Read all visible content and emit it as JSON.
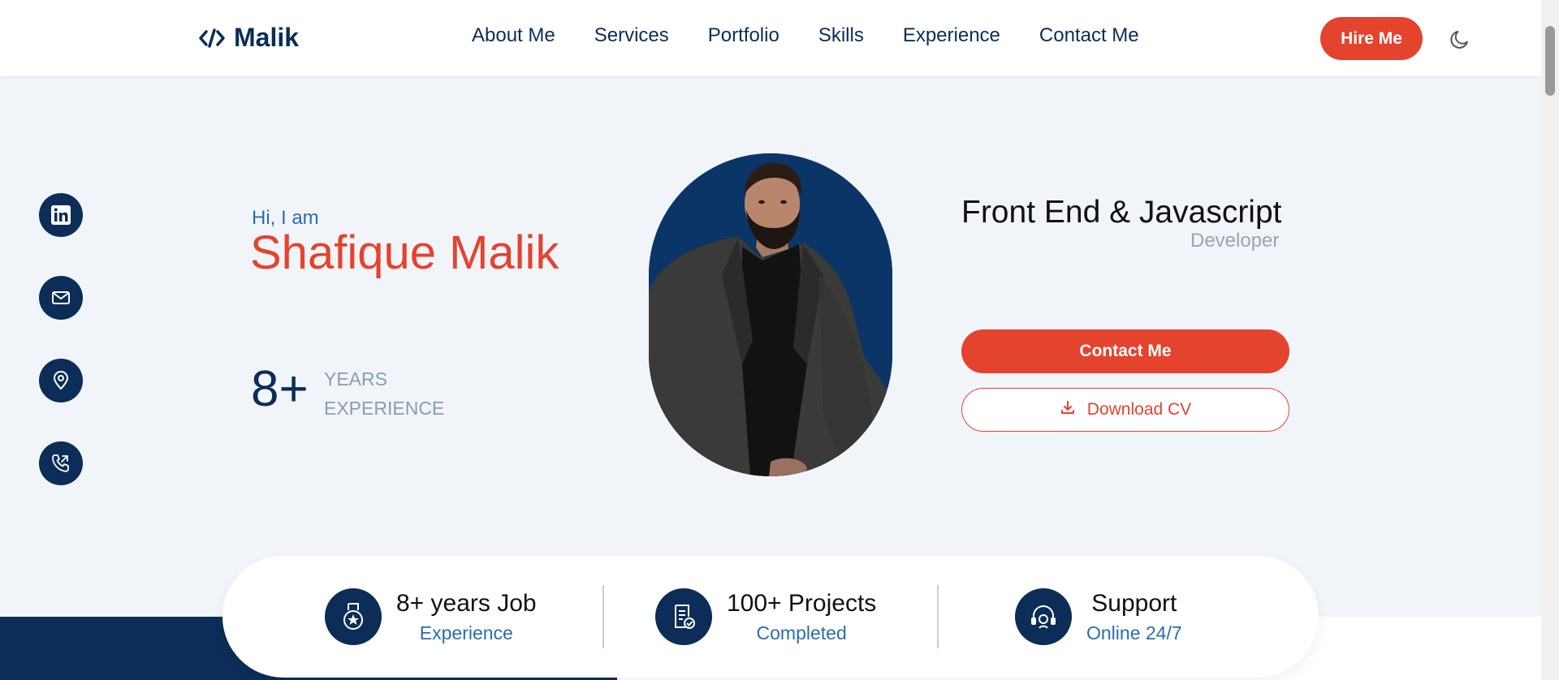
{
  "header": {
    "logo_text": "Malik",
    "nav": [
      {
        "label": "About Me"
      },
      {
        "label": "Services"
      },
      {
        "label": "Portfolio"
      },
      {
        "label": "Skills"
      },
      {
        "label": "Experience"
      },
      {
        "label": "Contact Me"
      }
    ],
    "hire_label": "Hire Me",
    "theme_icon": "moon-icon"
  },
  "social": [
    {
      "icon": "linkedin-icon"
    },
    {
      "icon": "mail-icon"
    },
    {
      "icon": "location-icon"
    },
    {
      "icon": "phone-icon"
    }
  ],
  "hero": {
    "greeting": "Hi, I am",
    "name": "Shafique Malik",
    "experience_number": "8+",
    "experience_label_line1": "YEARS",
    "experience_label_line2": "EXPERIENCE",
    "role_title": "Front End & Javascript",
    "role_subtitle": "Developer",
    "contact_label": "Contact Me",
    "download_label": "Download CV"
  },
  "stats": [
    {
      "title": "8+ years Job",
      "subtitle": "Experience",
      "icon": "medal-icon"
    },
    {
      "title": "100+ Projects",
      "subtitle": "Completed",
      "icon": "document-check-icon"
    },
    {
      "title": "Support",
      "subtitle": "Online 24/7",
      "icon": "headset-icon"
    }
  ],
  "colors": {
    "primary": "#0b2d57",
    "accent": "#e4432e",
    "link_blue": "#2a6db2",
    "background": "#f1f5fa"
  }
}
